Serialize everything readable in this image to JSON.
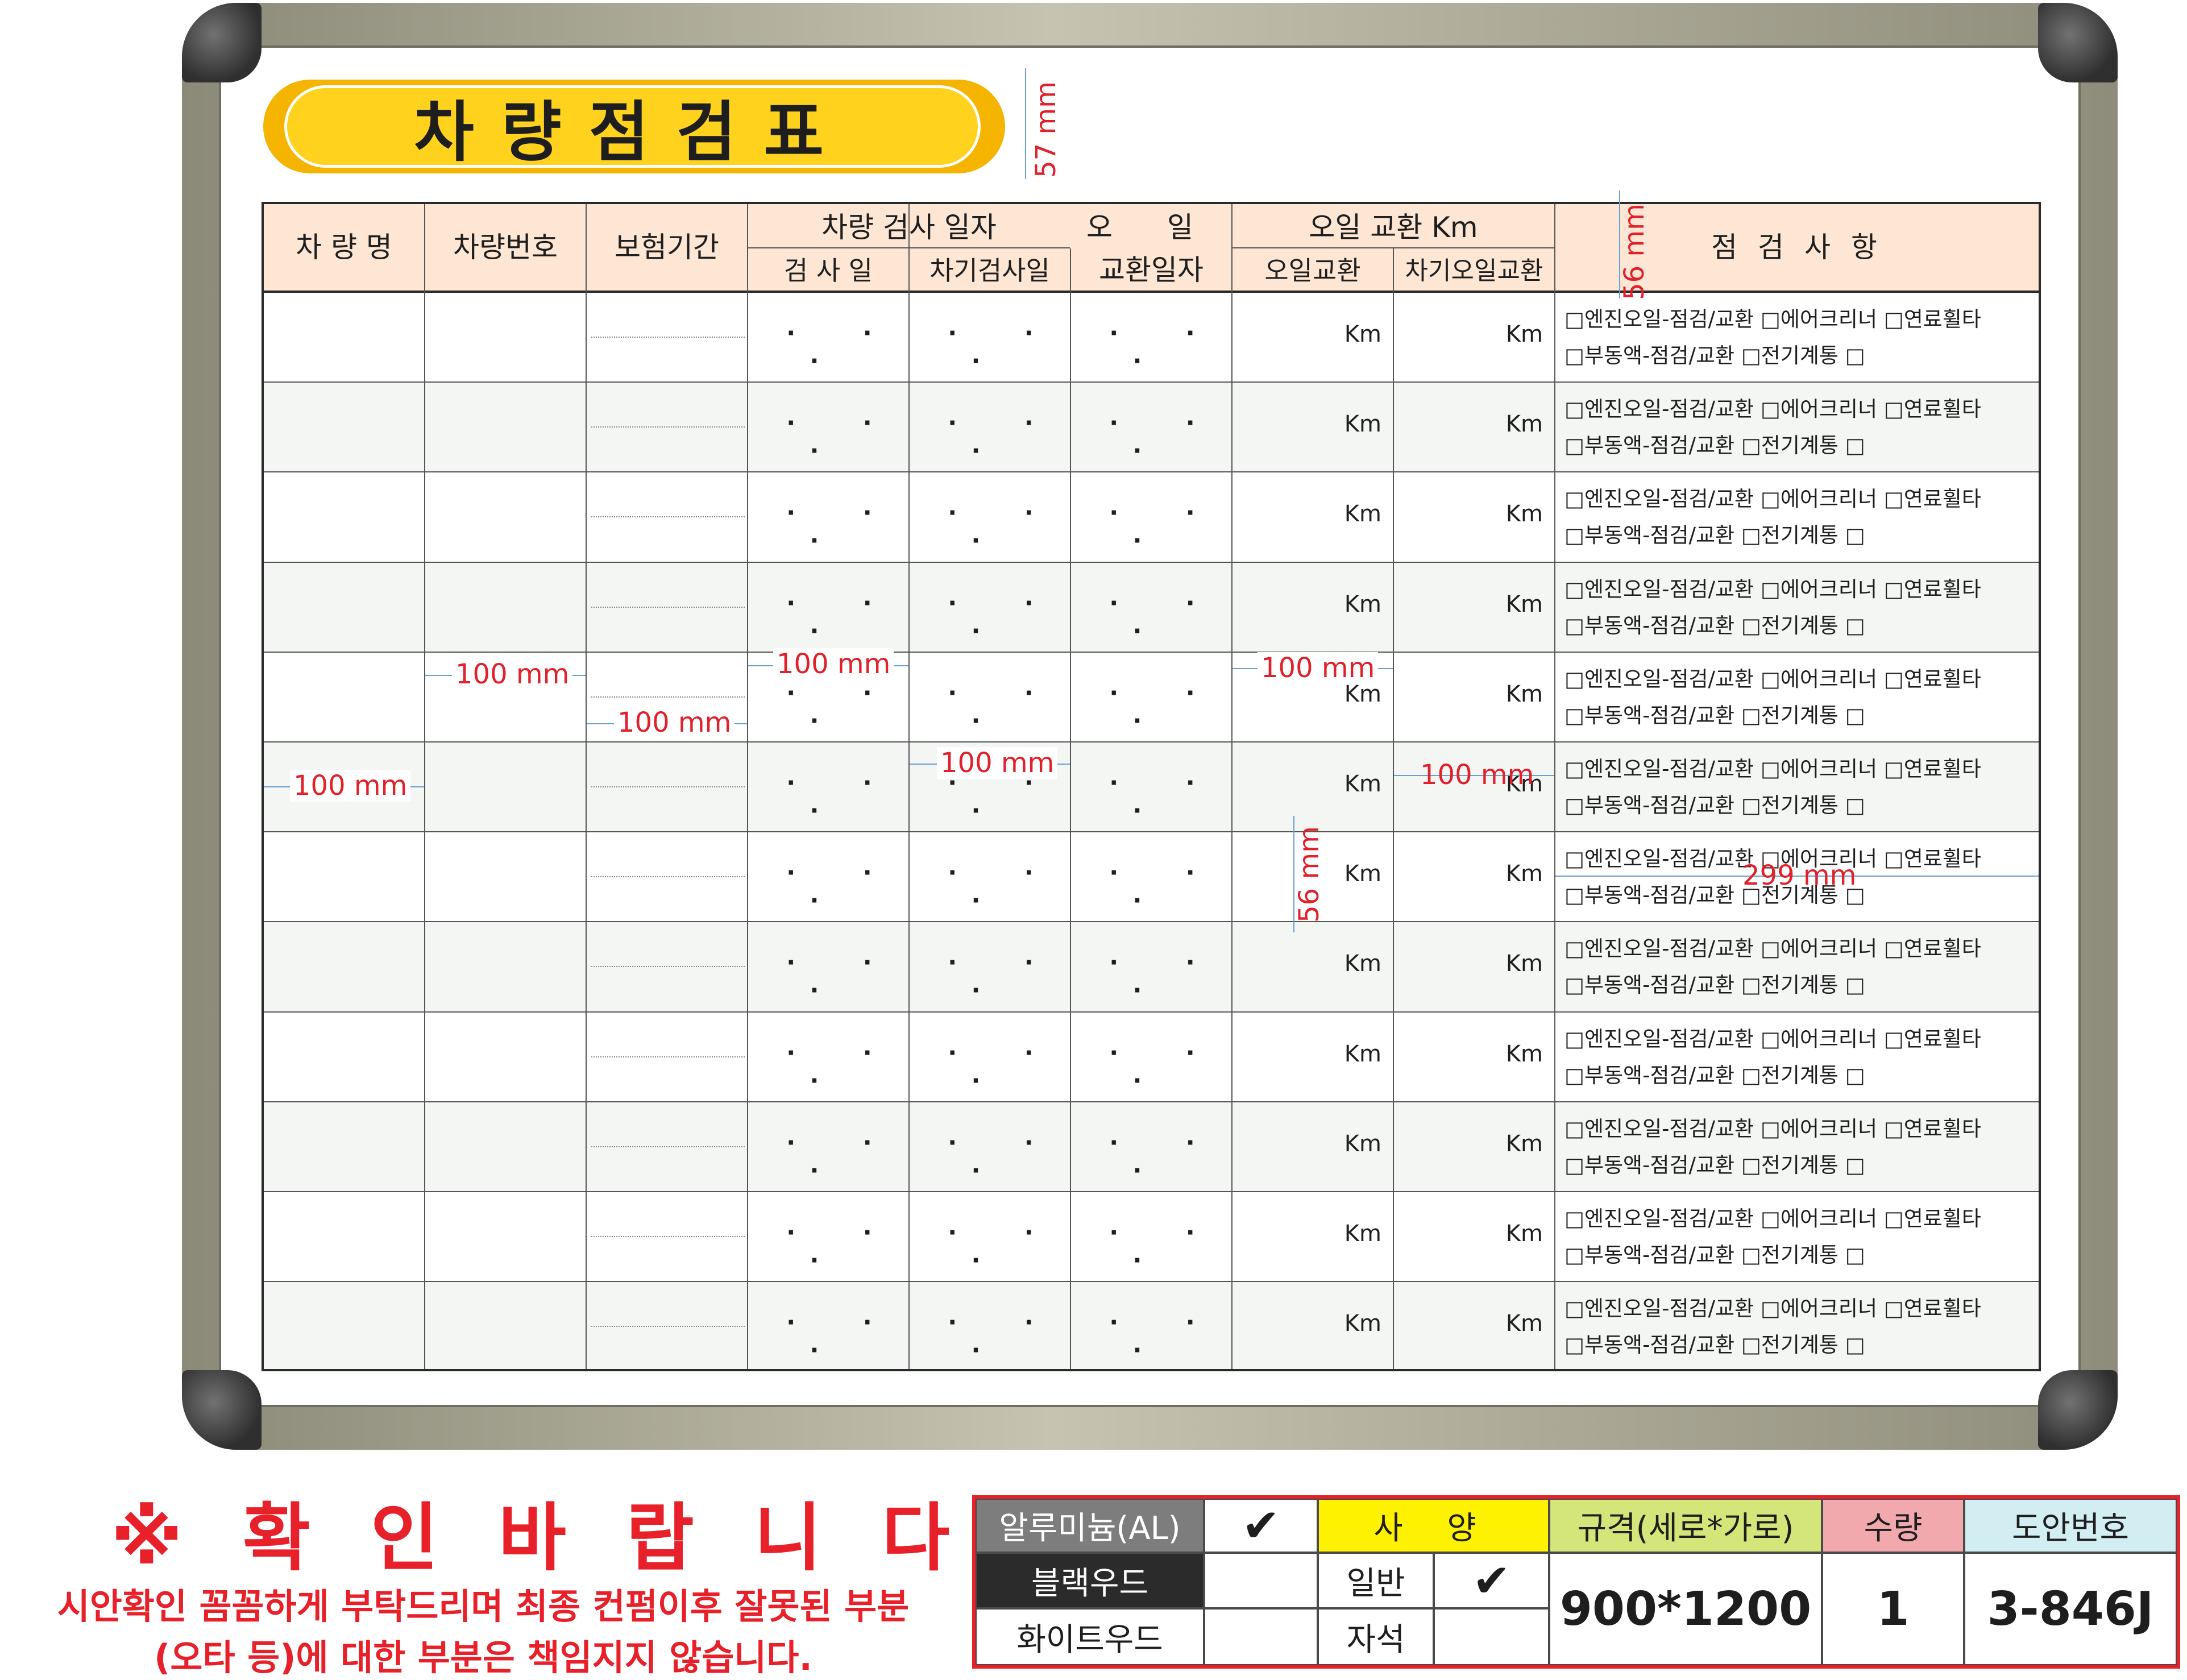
{
  "title": "차량점검표",
  "header": {
    "vehicle_name": "차 량 명",
    "vehicle_number": "차량번호",
    "insurance_period": "보험기간",
    "inspection_date_group": "차량 검사 일자",
    "inspection_day": "검 사 일",
    "next_inspection_day": "차기검사일",
    "oil_change_date_1": "오 일",
    "oil_change_date_2": "교환일자",
    "oil_change_km_group": "오일 교환 Km",
    "oil_change": "오일교환",
    "next_oil_change": "차기오일교환",
    "checklist": "점 검 사 항"
  },
  "row_template": {
    "date_dots": "· · ·",
    "km_unit": "Km",
    "check_line_1": "□엔진오일-점검/교환   □에어크리너   □연료휠타",
    "check_line_2": "□부동액-점검/교환   □전기계통  □"
  },
  "row_count": 12,
  "dimensions": {
    "title_height": "57 mm",
    "header_height": "56 mm",
    "row_height": "56 mm",
    "col_width": "100 mm",
    "check_col_width": "299 mm"
  },
  "notice": {
    "title": "※ 확 인 바 랍 니 다 ※",
    "line1": "시안확인 꼼꼼하게 부탁드리며 최종 컨펌이후 잘못된 부분",
    "line2": "(오타 등)에 대한 부분은 책임지지 않습니다."
  },
  "spec": {
    "aluminum": "알루미늄(AL)",
    "black_wood": "블랙우드",
    "white_wood": "화이트우드",
    "check_mark": "✔",
    "spec_label": "사 양",
    "normal": "일반",
    "magnetic": "자석",
    "size_label": "규격(세로*가로)",
    "size_value": "900*1200",
    "qty_label": "수량",
    "qty_value": "1",
    "design_no_label": "도안번호",
    "design_no_value": "3-846J"
  },
  "colors": {
    "frame": "#b4b29e",
    "title_fill": "#ffd21e",
    "header_fill": "#fde6d3",
    "dimension_red": "#e0202a",
    "spec_border": "#e8202a"
  }
}
